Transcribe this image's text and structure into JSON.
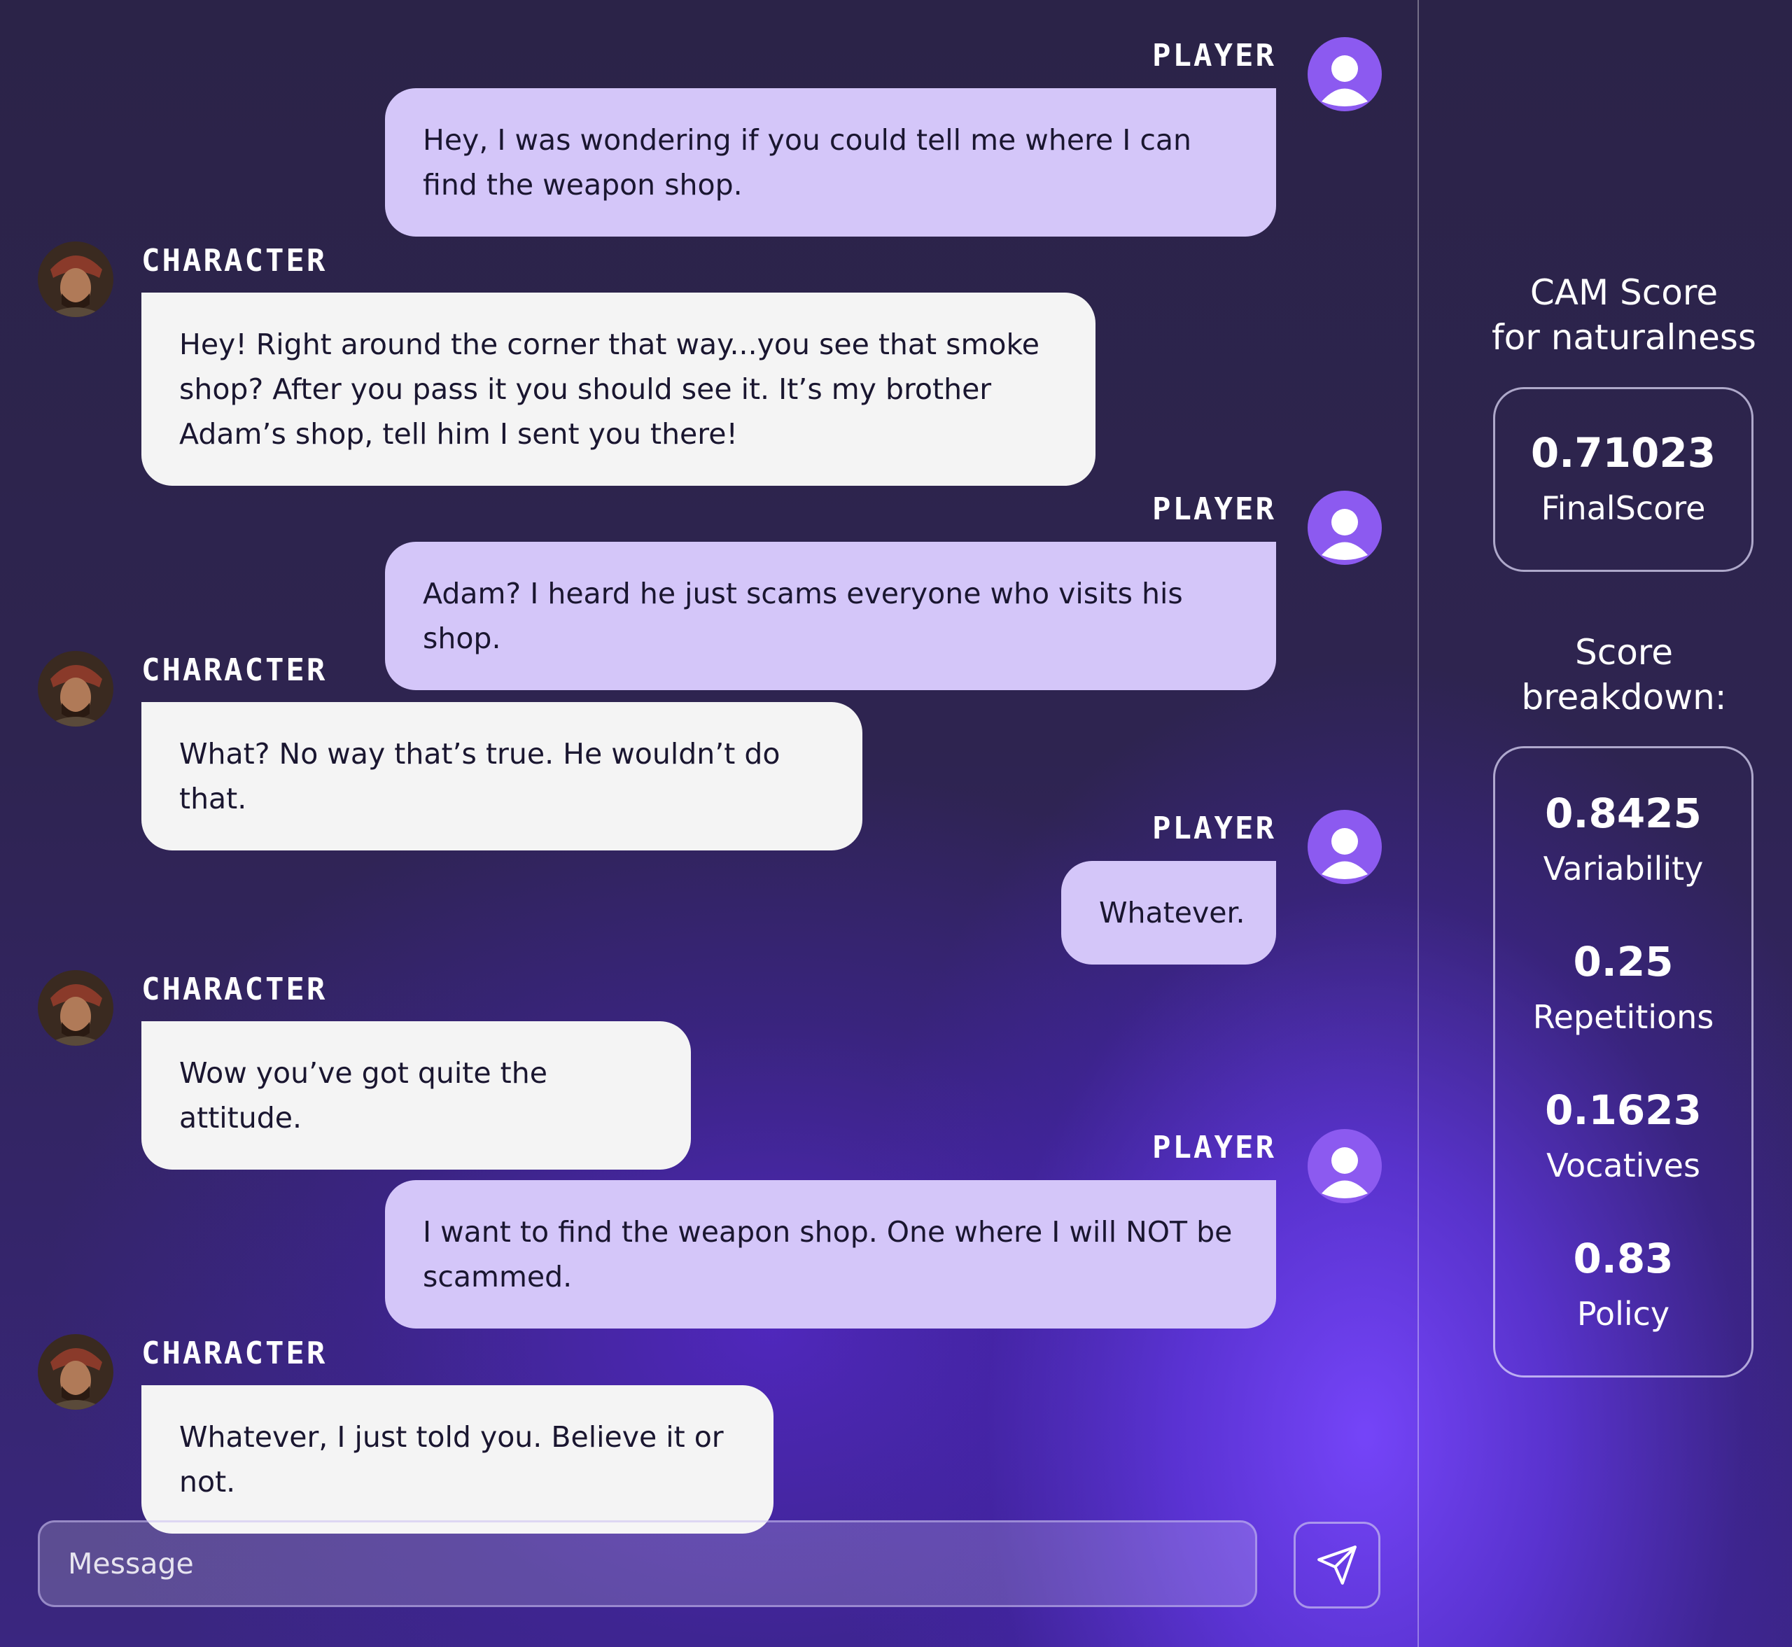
{
  "conversation": [
    {
      "role": "player",
      "label": "PLAYER",
      "text": "Hey, I was wondering if you could tell me where I can find the weapon shop."
    },
    {
      "role": "character",
      "label": "CHARACTER",
      "text": "Hey! Right around the corner that way...you see that smoke shop? After you pass it you should see it. It’s my brother Adam’s shop, tell him I sent you there!"
    },
    {
      "role": "player",
      "label": "PLAYER",
      "text": "Adam? I heard he just scams everyone who visits his shop."
    },
    {
      "role": "character",
      "label": "CHARACTER",
      "text": "What? No way that’s true. He wouldn’t do that."
    },
    {
      "role": "player",
      "label": "PLAYER",
      "text": "Whatever."
    },
    {
      "role": "character",
      "label": "CHARACTER",
      "text": "Wow you’ve got quite the attitude."
    },
    {
      "role": "player",
      "label": "PLAYER",
      "text": "I want to find the weapon shop. One where I will NOT be scammed."
    },
    {
      "role": "character",
      "label": "CHARACTER",
      "text": "Whatever, I just told you. Believe it or not."
    }
  ],
  "composer": {
    "placeholder": "Message",
    "value": ""
  },
  "icons": {
    "player_avatar": "user-icon",
    "character_avatar": "character-portrait",
    "send": "paper-plane-icon"
  },
  "sidebar": {
    "final_heading": "CAM Score\nfor naturalness",
    "final_score": {
      "value": "0.71023",
      "label": "FinalScore"
    },
    "breakdown_heading": "Score\nbreakdown:",
    "breakdown": [
      {
        "value": "0.8425",
        "label": "Variability"
      },
      {
        "value": "0.25",
        "label": "Repetitions"
      },
      {
        "value": "0.1623",
        "label": "Vocatives"
      },
      {
        "value": "0.83",
        "label": "Policy"
      }
    ]
  },
  "colors": {
    "player_bubble": "#d4c6f9",
    "character_bubble": "#f4f4f4",
    "accent": "#8c5af0"
  }
}
